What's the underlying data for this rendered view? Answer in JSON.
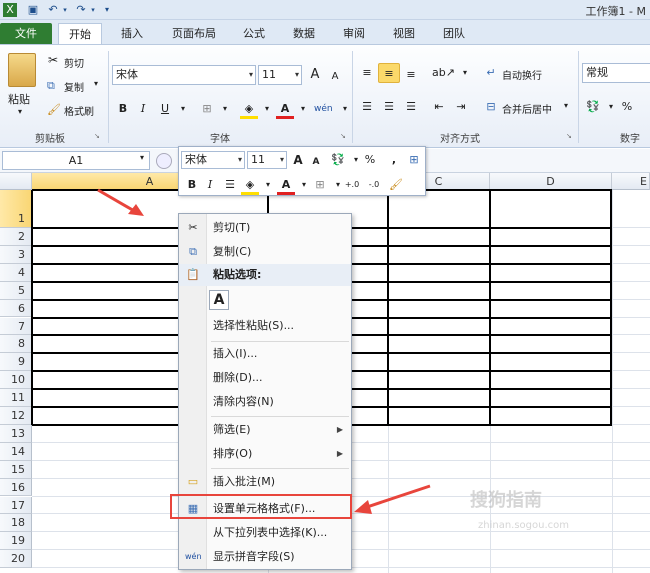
{
  "titlebar": {
    "title": "工作簿1 - M"
  },
  "tabs": [
    "文件",
    "开始",
    "插入",
    "页面布局",
    "公式",
    "数据",
    "审阅",
    "视图",
    "团队"
  ],
  "ribbon": {
    "clipboard": {
      "paste": "粘贴",
      "cut": "剪切",
      "copy": "复制",
      "format_painter": "格式刷",
      "label": "剪贴板"
    },
    "font": {
      "name": "宋体",
      "size": "11",
      "bold": "B",
      "italic": "I",
      "underline": "U",
      "label": "字体",
      "grow": "A",
      "shrink": "A"
    },
    "alignment": {
      "wrap": "自动换行",
      "merge": "合并后居中",
      "label": "对齐方式"
    },
    "number": {
      "format": "常规",
      "percent": "%",
      "label": "数字"
    }
  },
  "formula_bar": {
    "name_box": "A1"
  },
  "mini_toolbar": {
    "font": "宋体",
    "size": "11",
    "percent": "%",
    "comma": ",",
    "bold": "B",
    "italic": "I"
  },
  "grid": {
    "columns": [
      "A",
      "C",
      "D",
      "E"
    ],
    "rows": [
      "1",
      "2",
      "3",
      "4",
      "5",
      "6",
      "7",
      "8",
      "9",
      "10",
      "11",
      "12",
      "13",
      "14",
      "15",
      "16",
      "17",
      "18",
      "19",
      "20"
    ]
  },
  "context_menu": {
    "items": [
      {
        "label": "剪切(T)",
        "icon": "scissors-icon"
      },
      {
        "label": "复制(C)",
        "icon": "copy-icon"
      },
      {
        "label": "粘贴选项:",
        "icon": "paste-icon"
      },
      {
        "label": "A",
        "icon": "paste-text-icon"
      },
      {
        "label": "选择性粘贴(S)..."
      },
      {
        "label": "插入(I)..."
      },
      {
        "label": "删除(D)..."
      },
      {
        "label": "清除内容(N)"
      },
      {
        "label": "筛选(E)"
      },
      {
        "label": "排序(O)"
      },
      {
        "label": "插入批注(M)",
        "icon": "comment-icon"
      },
      {
        "label": "设置单元格格式(F)...",
        "icon": "format-cells-icon"
      },
      {
        "label": "从下拉列表中选择(K)..."
      },
      {
        "label": "显示拼音字段(S)",
        "icon": "phonetic-icon"
      }
    ]
  },
  "watermark": {
    "text": "搜狗指南",
    "url": "zhinan.sogou.com"
  },
  "colors": {
    "file_tab": "#2f7d32",
    "highlight": "#e8453c",
    "selection": "#f9d674"
  }
}
